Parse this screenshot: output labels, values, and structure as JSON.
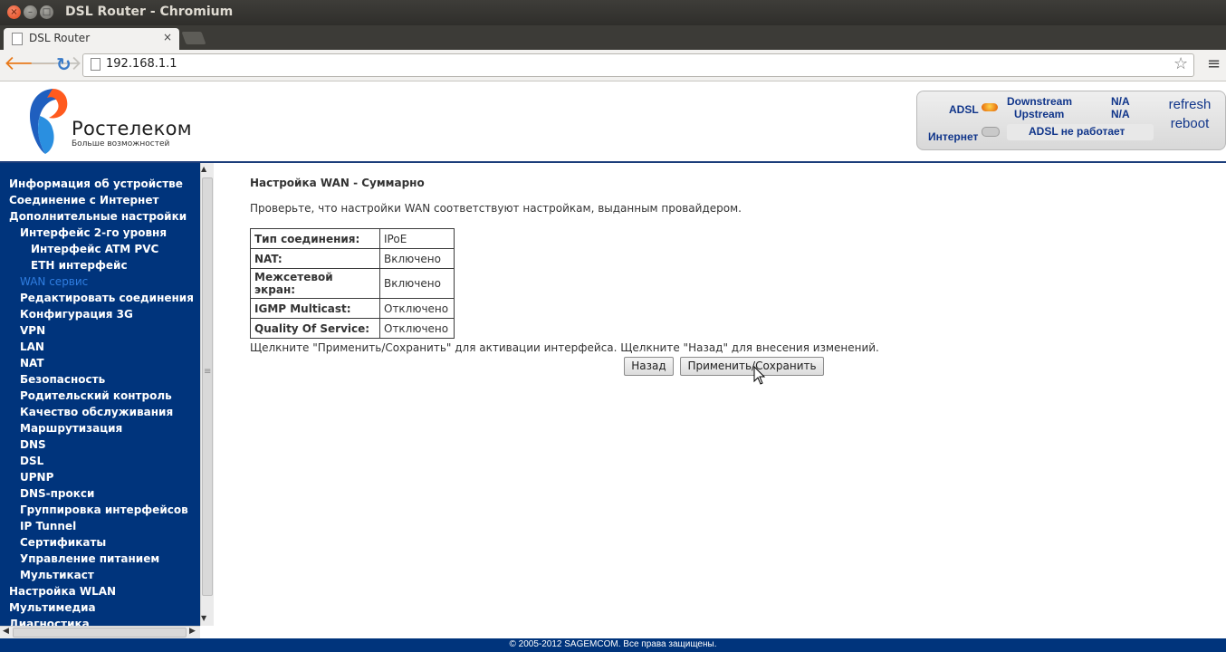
{
  "window": {
    "title": "DSL Router - Chromium"
  },
  "browser": {
    "tab_title": "DSL Router",
    "tab_close": "×",
    "url": "192.168.1.1"
  },
  "header": {
    "logo_name": "Ростелеком",
    "logo_tagline": "Больше возможностей",
    "status": {
      "adsl_label": "ADSL",
      "internet_label": "Интернет",
      "downstream_label": "Downstream",
      "upstream_label": "Upstream",
      "downstream_value": "N/A",
      "upstream_value": "N/A",
      "adsl_message": "ADSL не работает",
      "adsl_led_color": "#f07a10",
      "internet_led_color": "#c9c9c9"
    },
    "refresh_label": "refresh",
    "reboot_label": "reboot"
  },
  "sidebar": {
    "items": [
      {
        "label": "Информация об устройстве",
        "level": 0
      },
      {
        "label": "Соединение с Интернет",
        "level": 0
      },
      {
        "label": "Дополнительные настройки",
        "level": 0
      },
      {
        "label": "Интерфейс 2-го уровня",
        "level": 1
      },
      {
        "label": "Интерфейс ATM PVC",
        "level": 2
      },
      {
        "label": "ETH интерфейс",
        "level": 2
      },
      {
        "label": "WAN сервис",
        "level": 1,
        "active": true
      },
      {
        "label": "Редактировать соединения",
        "level": 1
      },
      {
        "label": "Конфигурация 3G",
        "level": 1
      },
      {
        "label": "VPN",
        "level": 1
      },
      {
        "label": "LAN",
        "level": 1
      },
      {
        "label": "NAT",
        "level": 1
      },
      {
        "label": "Безопасность",
        "level": 1
      },
      {
        "label": "Родительский контроль",
        "level": 1
      },
      {
        "label": "Качество обслуживания",
        "level": 1
      },
      {
        "label": "Маршрутизация",
        "level": 1
      },
      {
        "label": "DNS",
        "level": 1
      },
      {
        "label": "DSL",
        "level": 1
      },
      {
        "label": "UPNP",
        "level": 1
      },
      {
        "label": "DNS-прокси",
        "level": 1
      },
      {
        "label": "Группировка интерфейсов",
        "level": 1
      },
      {
        "label": "IP Tunnel",
        "level": 1
      },
      {
        "label": "Сертификаты",
        "level": 1
      },
      {
        "label": "Управление питанием",
        "level": 1
      },
      {
        "label": "Мультикаст",
        "level": 1
      },
      {
        "label": "Настройка WLAN",
        "level": 0
      },
      {
        "label": "Мультимедиа",
        "level": 0
      },
      {
        "label": "Диагностика",
        "level": 0
      }
    ]
  },
  "main": {
    "title": "Настройка WAN - Суммарно",
    "description": "Проверьте, что настройки WAN соответствуют настройкам, выданным провайдером.",
    "summary": [
      {
        "key": "Тип соединения:",
        "value": "IPoE"
      },
      {
        "key": "NAT:",
        "value": "Включено"
      },
      {
        "key": "Межсетевой экран:",
        "value": "Включено"
      },
      {
        "key": "IGMP Multicast:",
        "value": "Отключено"
      },
      {
        "key": "Quality Of Service:",
        "value": "Отключено"
      }
    ],
    "hint": "Щелкните \"Применить/Сохранить\" для активации интерфейса. Щелкните \"Назад\" для внесения изменений.",
    "back_label": "Назад",
    "apply_label": "Применить/Сохранить"
  },
  "footer": {
    "text": "© 2005-2012 SAGEMCOM. Все права защищены."
  },
  "colors": {
    "sidebar_bg": "#00347c",
    "active_item": "#2f7de0",
    "brand_blue": "#10358a"
  }
}
